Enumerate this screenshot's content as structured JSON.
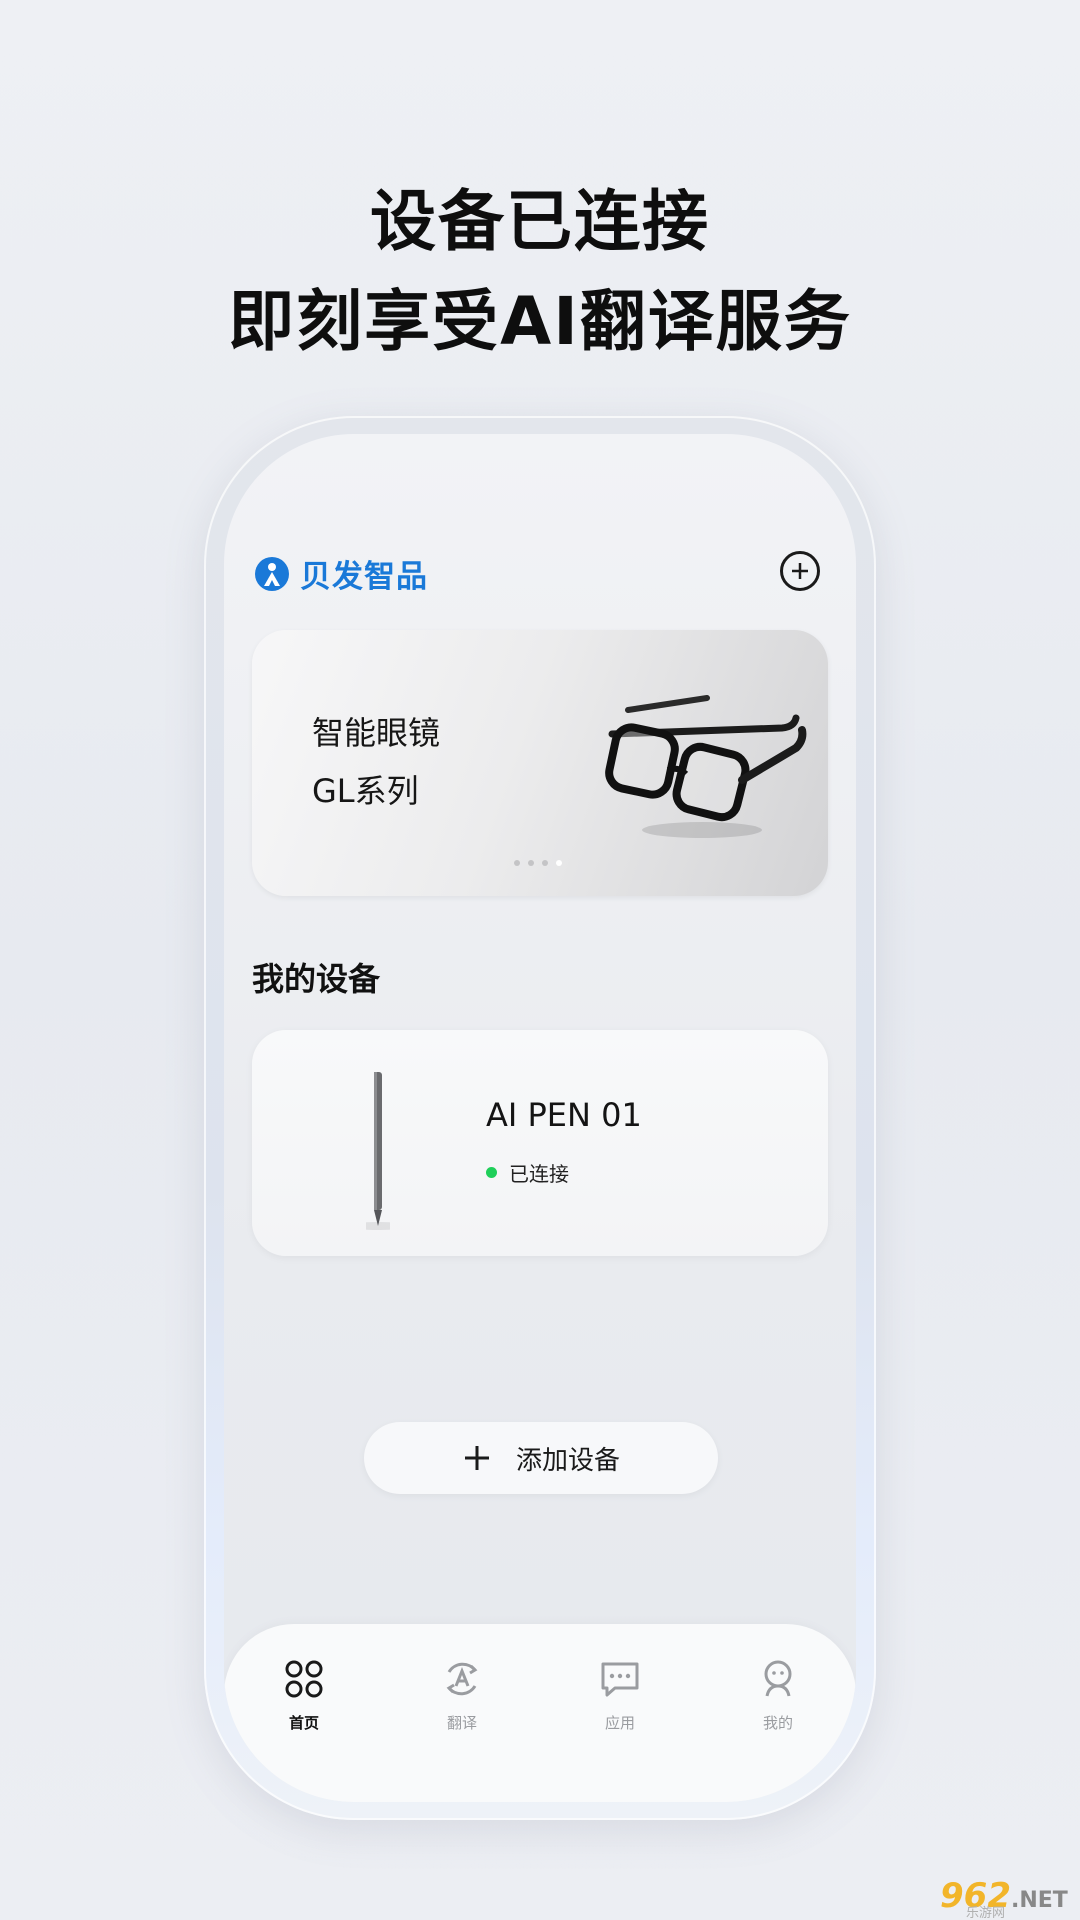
{
  "headline": {
    "line1": "设备已连接",
    "line2": "即刻享受AI翻译服务"
  },
  "app": {
    "brand_name": "贝发智品",
    "brand_color": "#1a79d8",
    "add_icon": "plus-circle-icon"
  },
  "banner": {
    "title": "智能眼镜",
    "subtitle": "GL系列",
    "page_count": 4,
    "active_page": 4
  },
  "devices": {
    "section_title": "我的设备",
    "items": [
      {
        "name": "AI PEN 01",
        "status": "已连接",
        "status_color": "#1fcf5a"
      }
    ]
  },
  "add_device": {
    "label": "添加设备"
  },
  "tabbar": {
    "tabs": [
      {
        "label": "首页",
        "icon": "home-grid-icon",
        "active": true
      },
      {
        "label": "翻译",
        "icon": "translate-icon",
        "active": false
      },
      {
        "label": "应用",
        "icon": "chat-apps-icon",
        "active": false
      },
      {
        "label": "我的",
        "icon": "profile-icon",
        "active": false
      }
    ]
  },
  "watermark": {
    "main": "962",
    "suffix": ".NET",
    "sub": "乐游网"
  }
}
